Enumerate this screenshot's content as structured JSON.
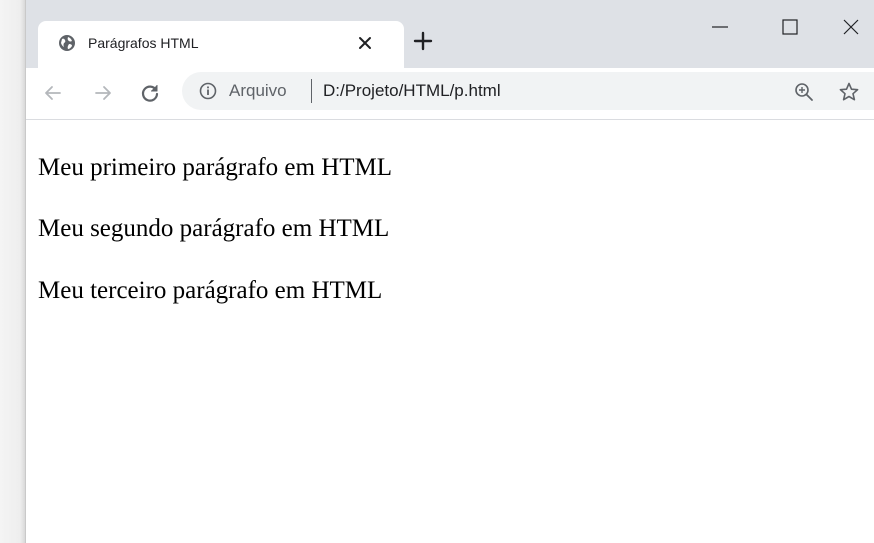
{
  "tab": {
    "title": "Parágrafos HTML",
    "favicon": "globe-icon"
  },
  "address_bar": {
    "scheme_label": "Arquivo",
    "path": "D:/Projeto/HTML/p.html"
  },
  "icons": {
    "back": "arrow-left-icon",
    "forward": "arrow-right-icon",
    "reload": "reload-icon",
    "info": "info-icon",
    "zoom": "zoom-in-icon",
    "bookmark": "star-icon",
    "new_tab": "plus-icon",
    "tab_close": "close-icon",
    "minimize": "minimize-icon",
    "maximize": "maximize-icon",
    "close": "close-icon"
  },
  "colors": {
    "tabstrip": "#dee1e6",
    "omnibox": "#f1f3f4",
    "icon": "#5f6368",
    "text": "#202124"
  },
  "page": {
    "paragraphs": [
      "Meu primeiro parágrafo em HTML",
      "Meu segundo parágrafo em HTML",
      "Meu terceiro parágrafo em HTML"
    ]
  }
}
